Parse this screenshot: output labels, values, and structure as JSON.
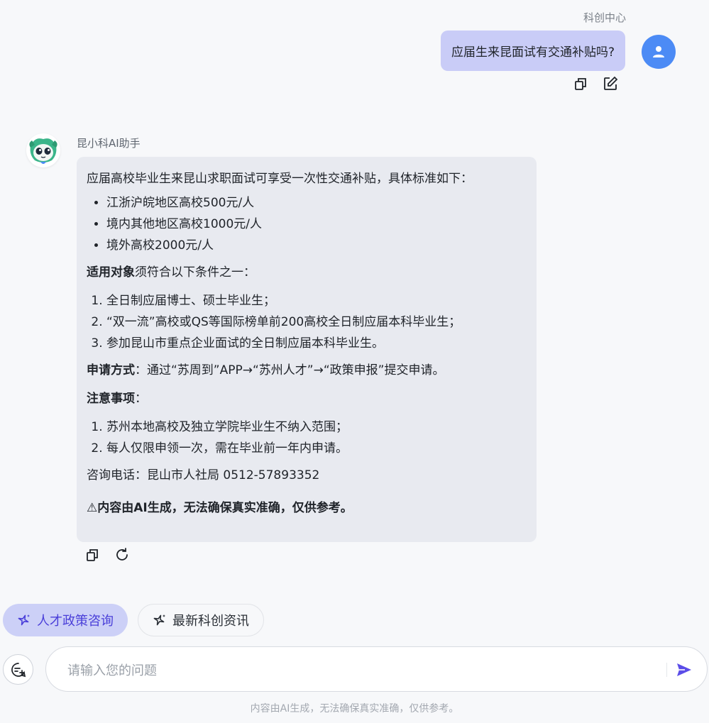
{
  "user": {
    "name": "科创中心",
    "message": "应届生来昆面试有交通补贴吗?"
  },
  "bot": {
    "name": "昆小科AI助手",
    "intro": "应届高校毕业生来昆山求职面试可享受一次性交通补贴，具体标准如下：",
    "subsidies": [
      "江浙沪皖地区高校500元/人",
      "境内其他地区高校1000元/人",
      "境外高校2000元/人"
    ],
    "eligibility_label": "适用对象",
    "eligibility_text": "须符合以下条件之一：",
    "eligibility_items": [
      "全日制应届博士、硕士毕业生；",
      "“双一流”高校或QS等国际榜单前200高校全日制应届本科毕业生；",
      "参加昆山市重点企业面试的全日制应届本科毕业生。"
    ],
    "apply_label": "申请方式",
    "apply_text": "：通过“苏周到”APP→“苏州人才”→“政策申报”提交申请。",
    "notes_label": "注意事项",
    "notes_colon": "：",
    "notes_items": [
      "苏州本地高校及独立学院毕业生不纳入范围；",
      "每人仅限申领一次，需在毕业前一年内申请。"
    ],
    "contact": "咨询电话：昆山市人社局 0512-57893352",
    "warning_icon": "⚠",
    "warning": "内容由AI生成，无法确保真实准确，仅供参考。"
  },
  "chips": [
    {
      "label": "人才政策咨询",
      "icon": "sparkle-icon",
      "active": true
    },
    {
      "label": "最新科创资讯",
      "icon": "sparkle-icon",
      "active": false
    }
  ],
  "input": {
    "placeholder": "请输入您的问题"
  },
  "footer": {
    "disclaimer": "内容由AI生成，无法确保真实准确，仅供参考。"
  },
  "colors": {
    "user_bubble": "#c9ccf7",
    "user_avatar": "#4c8bf5",
    "bot_bubble": "#e8eaf0",
    "accent": "#4a3fd9",
    "send": "#5b4de8"
  }
}
